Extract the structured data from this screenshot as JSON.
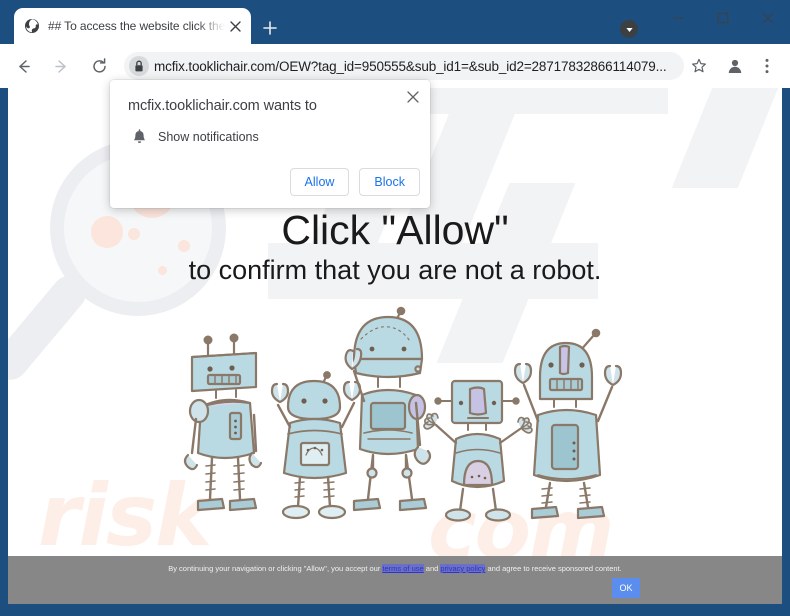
{
  "browser": {
    "tab": {
      "title": "## To access the website click the",
      "favicon": "globe-icon",
      "close_label": "×"
    },
    "new_tab_label": "+",
    "window_controls": {
      "minimize": "–",
      "maximize": "□",
      "close": "×",
      "update_badge": "update-icon"
    },
    "toolbar": {
      "back": "back-arrow-icon",
      "forward": "forward-arrow-icon",
      "reload": "reload-icon",
      "lock": "lock-icon",
      "url": "mcfix.tooklichair.com/OEW?tag_id=950555&sub_id1=&sub_id2=28717832866114079...",
      "bookmark": "star-icon",
      "profile": "profile-icon",
      "menu": "three-dot-menu-icon"
    }
  },
  "permission_dialog": {
    "title": "mcfix.tooklichair.com wants to",
    "permission_icon": "bell-icon",
    "permission_label": "Show notifications",
    "allow_label": "Allow",
    "block_label": "Block",
    "close_label": "×"
  },
  "page": {
    "headline": "Click \"Allow\"",
    "subhead": "to confirm that you are not a robot.",
    "illustration": "five-cartoon-robots",
    "watermark": {
      "magnifier": "magnifying-glass-watermark",
      "text_left": "risk",
      "text_right": "com"
    },
    "consent": {
      "text_before": "By continuing your navigation or clicking \"Allow\", you accept our",
      "link1": "terms of use",
      "between": "and",
      "link2": "privacy policy",
      "text_after": "and agree to receive sponsored content.",
      "ok_label": "OK"
    }
  },
  "colors": {
    "chrome_frame": "#1c4f80",
    "accent_blue": "#1a73e8",
    "consent_bar": "#878787",
    "ok_button": "#5b8dee",
    "robot_body": "#bcdbe4",
    "robot_outline": "#7c6a5d"
  }
}
